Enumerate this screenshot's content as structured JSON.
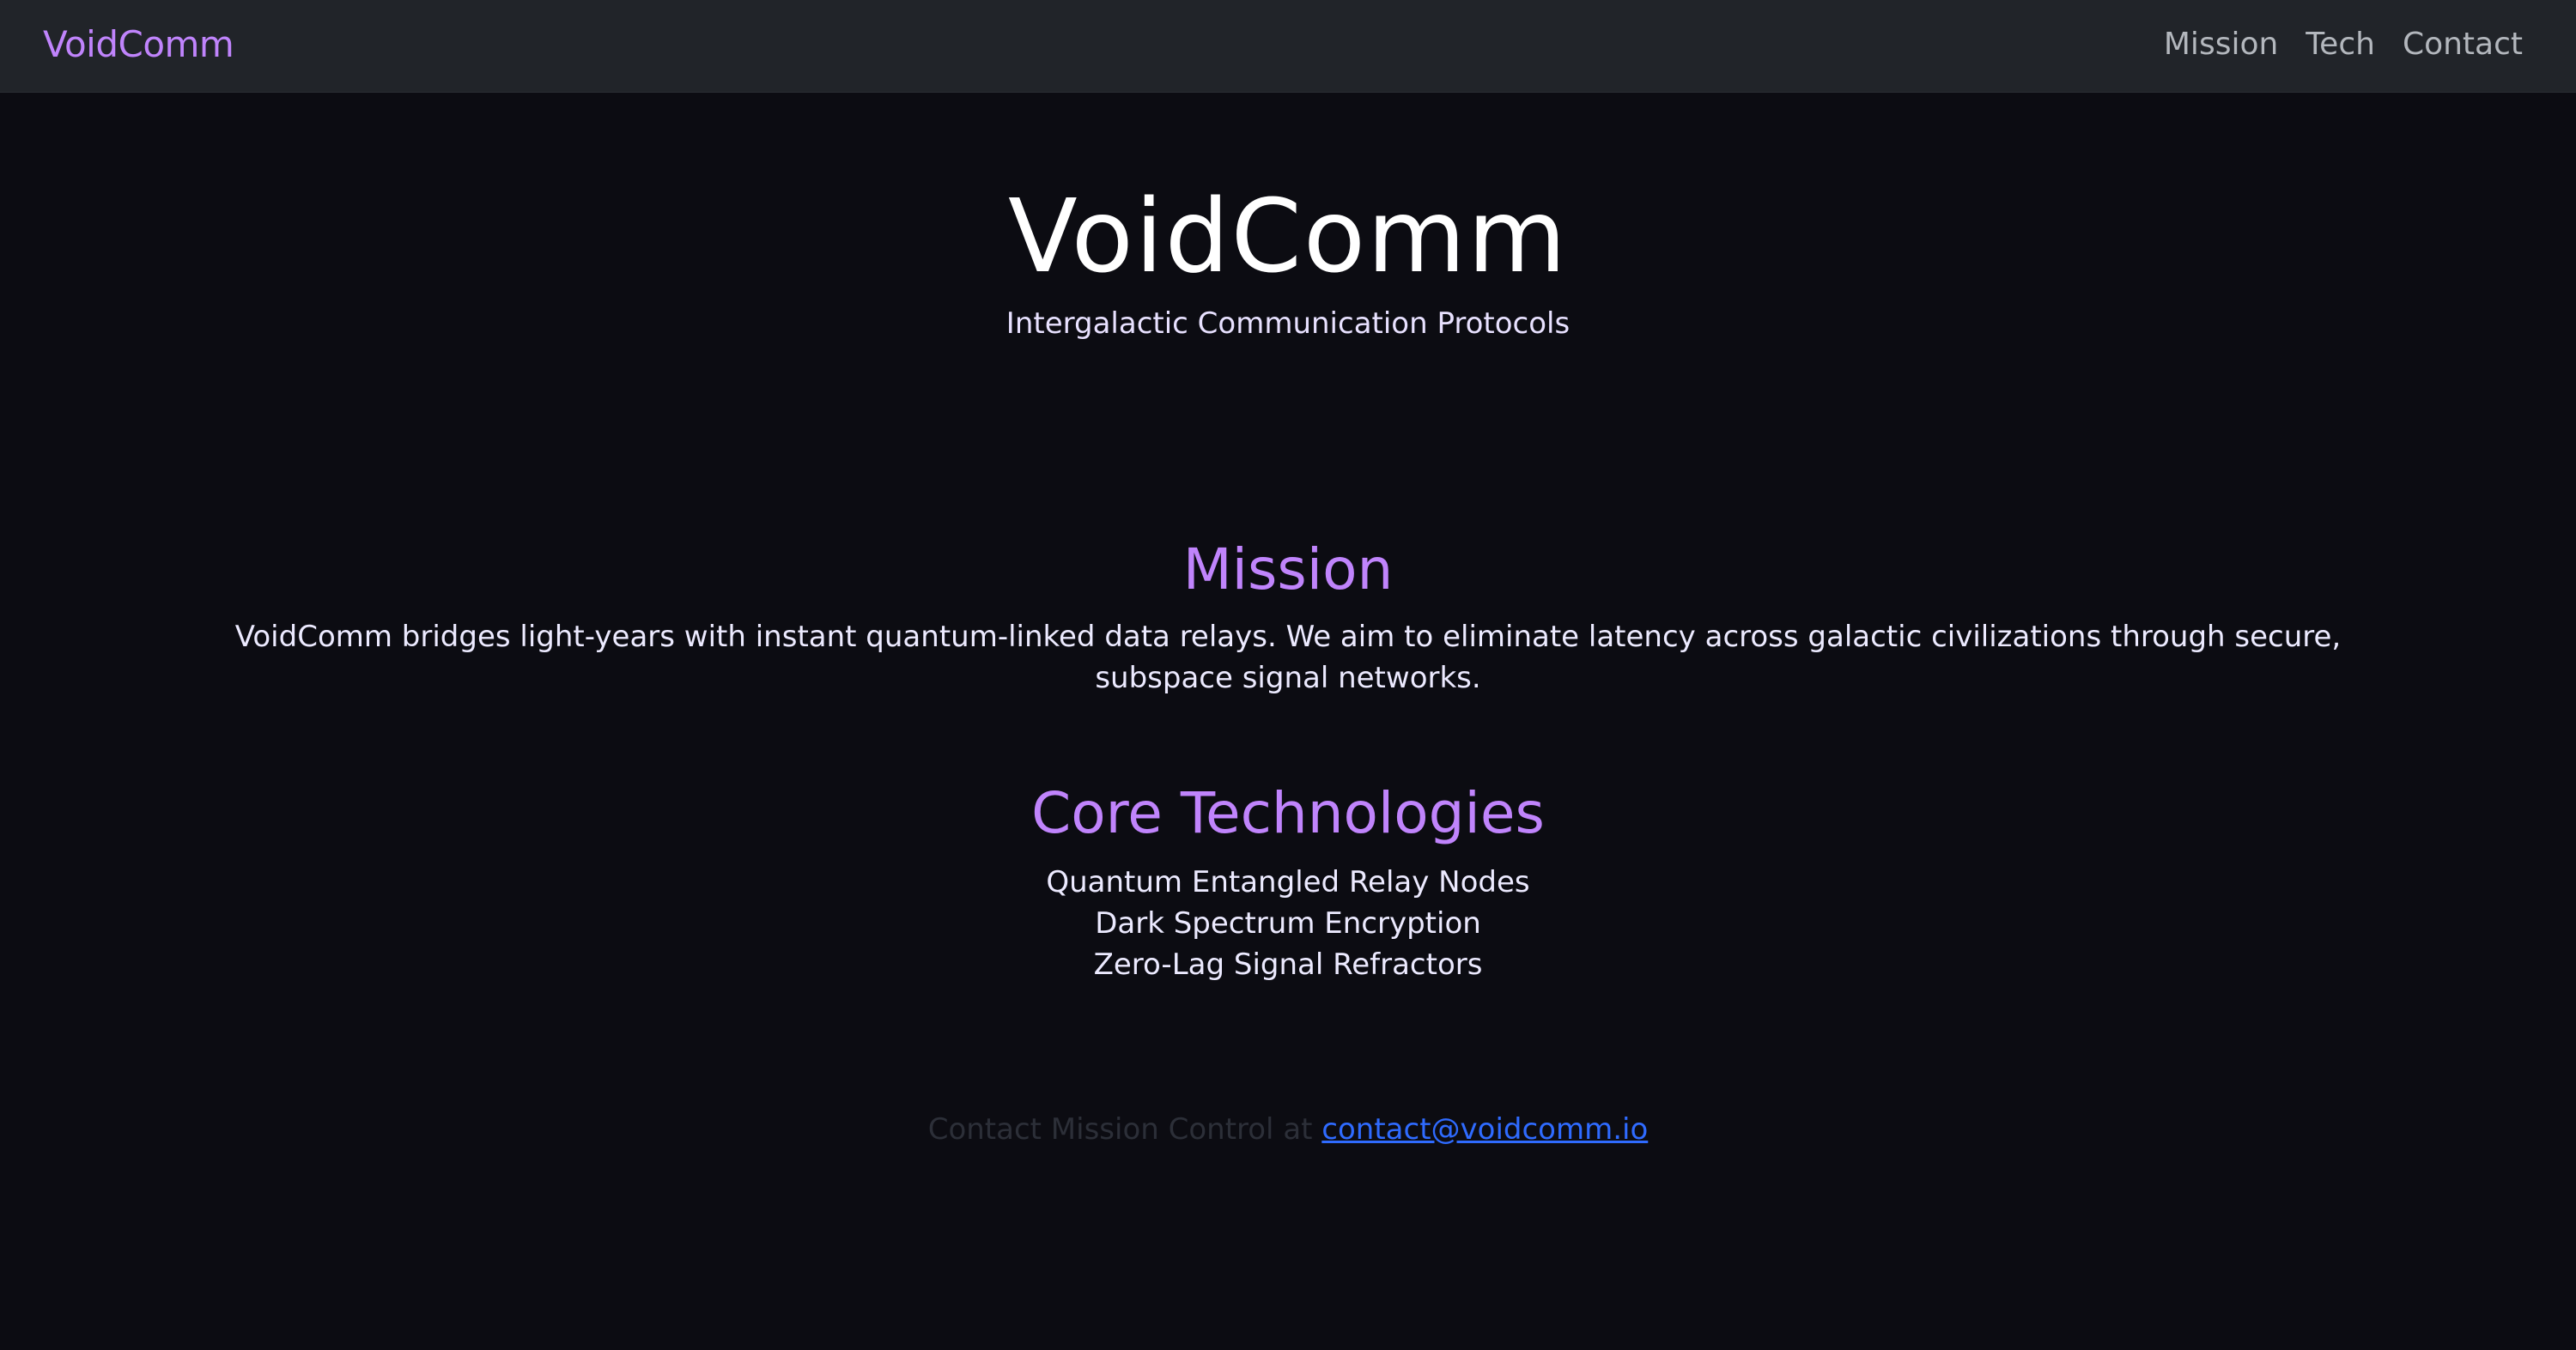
{
  "colors": {
    "background": "#0c0c12",
    "navbar": "#212429",
    "accent": "#c084fc",
    "text": "#eceaff",
    "link": "#2f6bff",
    "footer_text": "#2c2f38"
  },
  "navbar": {
    "brand": "VoidComm",
    "links": [
      "Mission",
      "Tech",
      "Contact"
    ]
  },
  "hero": {
    "title": "VoidComm",
    "subtitle": "Intergalactic Communication Protocols"
  },
  "mission": {
    "heading": "Mission",
    "text": "VoidComm bridges light-years with instant quantum-linked data relays. We aim to eliminate latency across galactic civilizations through secure, subspace signal networks."
  },
  "tech": {
    "heading": "Core Technologies",
    "items": [
      "Quantum Entangled Relay Nodes",
      "Dark Spectrum Encryption",
      "Zero-Lag Signal Refractors"
    ]
  },
  "footer": {
    "text": "Contact Mission Control at",
    "email": "contact@voidcomm.io"
  }
}
